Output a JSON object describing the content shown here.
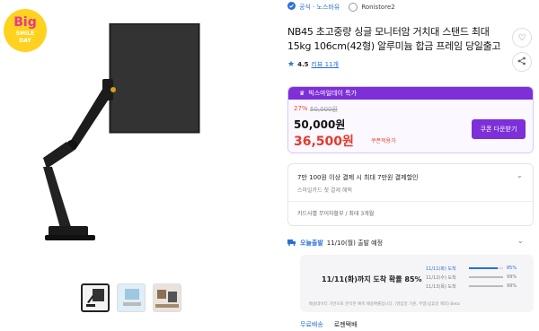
{
  "badge": {
    "line1": "Big",
    "line2": "SMILE",
    "line3": "DAY"
  },
  "seller": {
    "official_label": "공식 · 노스바유",
    "store_name": "Ronistore2"
  },
  "product": {
    "title": "NB45 초고중량 싱글 모니터암 거치대 스탠드 최대 15kg 106cm(42형) 알루미늄 합금 프레임 당일출고",
    "rating": "4.5",
    "review_label": "리뷰 11개"
  },
  "deal": {
    "header": "빅스마일데이 특가",
    "discount_pct": "27%",
    "original_price": "50,000원",
    "price": "50,000원",
    "final_price": "36,500원",
    "coupon_note": "쿠폰적용가",
    "coupon_button": "쿠폰 다운받기"
  },
  "benefit": {
    "line1": "7만 100원 이상 결제 시 최대 7만원 결제할인",
    "line2": "스마일카드 첫 결제 혜택",
    "line3": "카드사별 무이자할부 / 최대 3개월"
  },
  "shipping": {
    "today_label": "오늘출발",
    "eta": "11/10(월) 출발 예정",
    "arrival_msg": "11/11(화)까지 도착 확률 85%",
    "rows": [
      {
        "date": "11/11(화) 도착",
        "pct": "85%",
        "level": 0.85,
        "highlight": true
      },
      {
        "date": "11/12(수) 도착",
        "pct": "99%",
        "level": 0.99,
        "highlight": false
      },
      {
        "date": "11/13(목) 도착",
        "pct": "99%",
        "level": 0.99,
        "highlight": false
      }
    ],
    "note": "배송데이터 기반으로 분석한 예측 배송확률입니다. (영업일 기준, 주말/공휴일 제외) Beta",
    "tab_free": "무료배송",
    "tab_courier": "로젠택배"
  },
  "icons": {
    "heart": "heart-icon",
    "share": "share-icon",
    "verified": "verified-icon",
    "star": "star-icon",
    "chevron": "chevron-down-icon"
  },
  "colors": {
    "accent_purple": "#7d2fd8",
    "price_red": "#e53a2b",
    "link_blue": "#2b6fd6"
  }
}
